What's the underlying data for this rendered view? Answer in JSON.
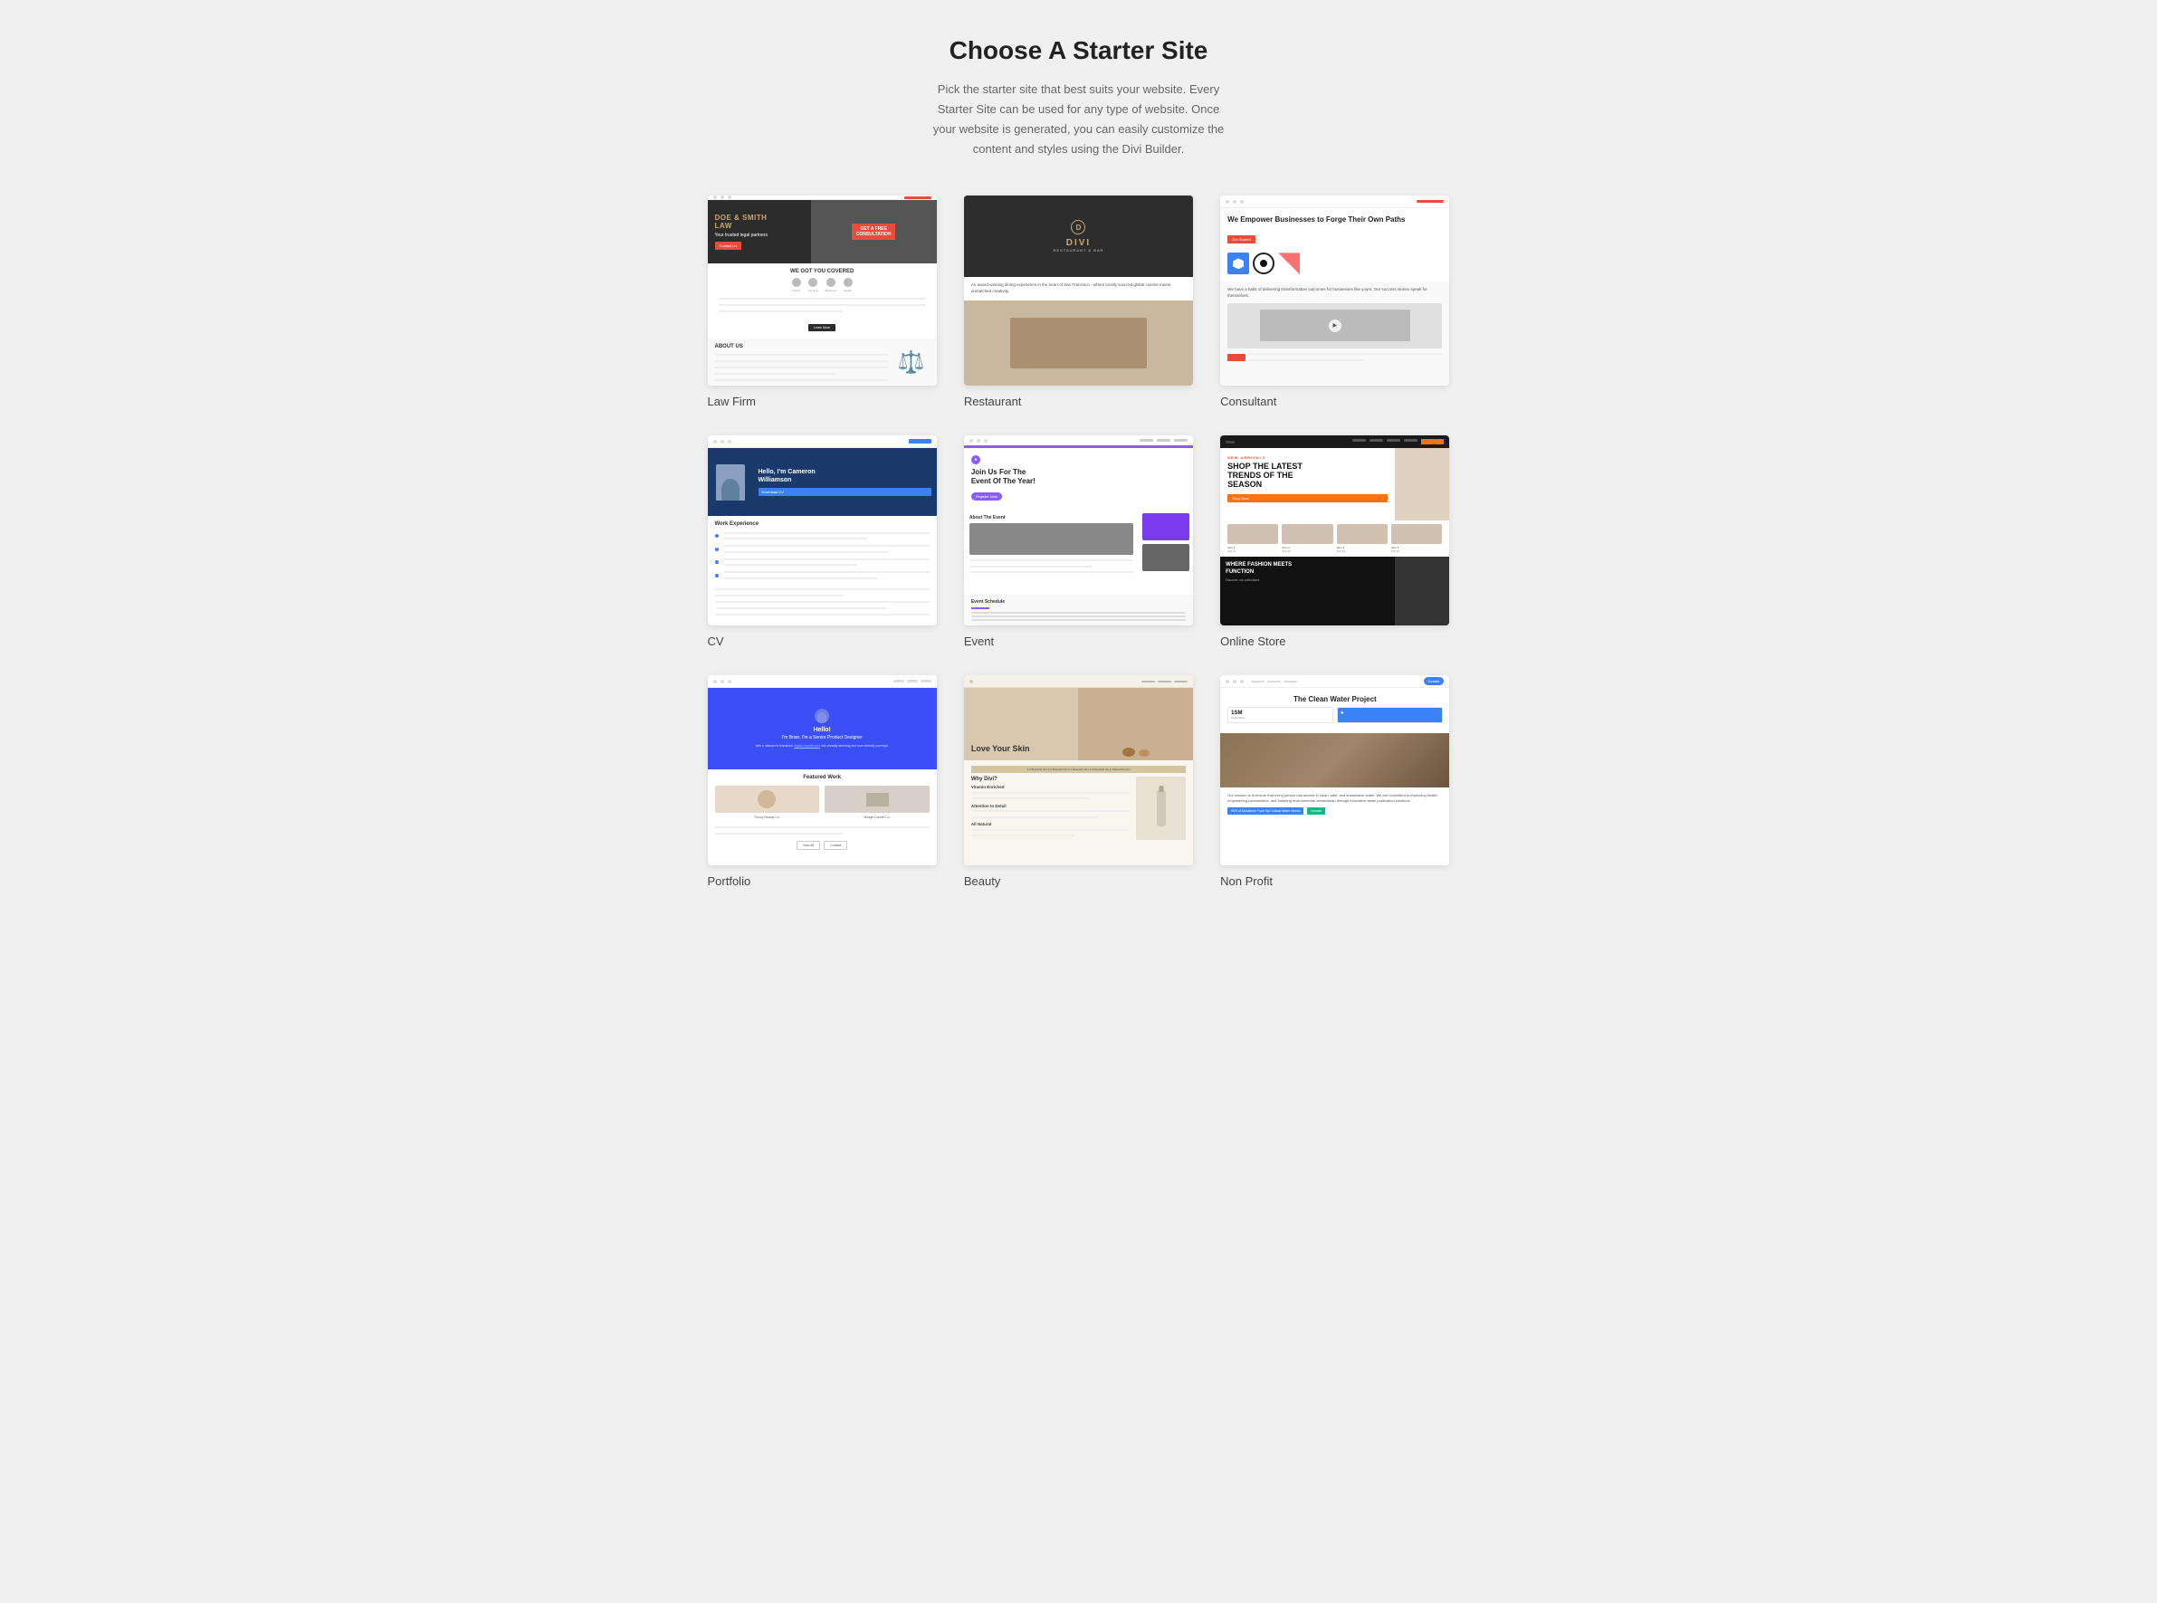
{
  "page": {
    "title": "Choose A Starter Site",
    "subtitle": "Pick the starter site that best suits your website. Every Starter Site can be used for any type of website. Once your website is generated, you can easily customize the content and styles using the Divi Builder."
  },
  "sites": [
    {
      "id": "law-firm",
      "label": "Law Firm",
      "type": "law-firm"
    },
    {
      "id": "restaurant",
      "label": "Restaurant",
      "type": "restaurant"
    },
    {
      "id": "consultant",
      "label": "Consultant",
      "type": "consultant"
    },
    {
      "id": "cv",
      "label": "CV",
      "type": "cv"
    },
    {
      "id": "event",
      "label": "Event",
      "type": "event"
    },
    {
      "id": "online-store",
      "label": "Online Store",
      "type": "online-store"
    },
    {
      "id": "portfolio",
      "label": "Portfolio",
      "type": "portfolio"
    },
    {
      "id": "beauty",
      "label": "Beauty",
      "type": "beauty"
    },
    {
      "id": "non-profit",
      "label": "Non Profit",
      "type": "non-profit"
    }
  ]
}
